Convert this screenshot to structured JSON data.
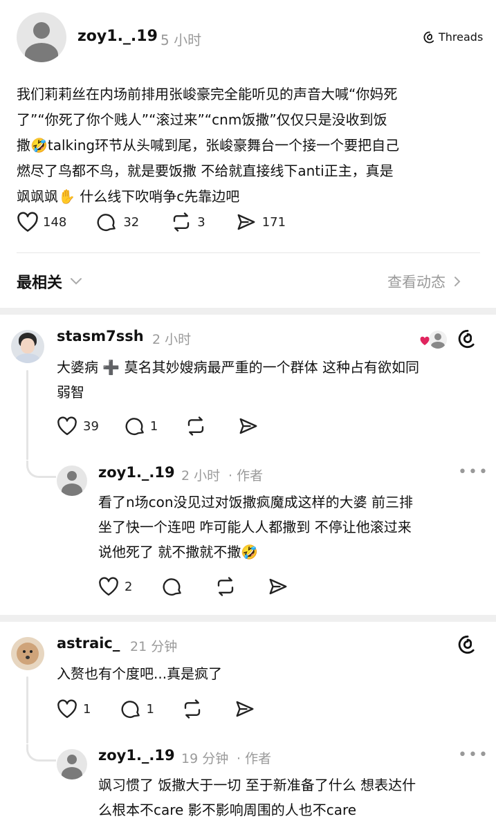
{
  "post": {
    "username": "zoy1._.19",
    "time": "5 小时",
    "brand": "Threads",
    "text_lines": [
      "我们莉莉丝在内场前排用张峻豪完全能听见的声音大喊“你妈死",
      "了”“你死了你个贱人”“滚过来”“cnm饭撒”仅仅只是没收到饭",
      "撒🤣talking环节从头喊到尾，张峻豪舞台一个接一个要把自己",
      "燃尽了鸟都不鸟，就是要饭撒 不给就直接线下anti正主，真是",
      "飒飒飒✋ 什么线下吹哨争c先靠边吧"
    ],
    "likes": "148",
    "comments": "32",
    "reposts": "3",
    "shares": "171"
  },
  "sort": {
    "label": "最相关",
    "activity_link": "查看动态"
  },
  "replies": [
    {
      "username": "stasm7ssh",
      "time": "2 小时",
      "text_lines": [
        "大婆病 ➕ 莫名其妙嫂病最严重的一个群体 这种占有欲如同",
        "弱智"
      ],
      "likes": "39",
      "comments": "1",
      "sub": {
        "username": "zoy1._.19",
        "time": "2 小时",
        "author_tag": "· 作者",
        "more": "•••",
        "text_lines": [
          "看了n场con没见过对饭撒疯魔成这样的大婆 前三排",
          "坐了快一个连吧 咋可能人人都撒到 不停让他滚过来",
          "说他死了 就不撒就不撒🤣"
        ],
        "likes": "2"
      }
    },
    {
      "username": "astraic_",
      "time": "21 分钟",
      "text_lines": [
        "入赘也有个度吧...真是疯了"
      ],
      "likes": "1",
      "comments": "1",
      "sub": {
        "username": "zoy1._.19",
        "time": "19 分钟",
        "author_tag": "· 作者",
        "more": "•••",
        "text_lines": [
          "飒习惯了 饭撒大于一切 至于新准备了什么 想表达什",
          "么根本不care 影不影响周围的人也不care"
        ]
      }
    }
  ],
  "icons": {
    "heart": "heart-icon",
    "comment": "comment-icon",
    "repost": "repost-icon",
    "share": "share-icon",
    "threads": "threads-logo-icon"
  }
}
